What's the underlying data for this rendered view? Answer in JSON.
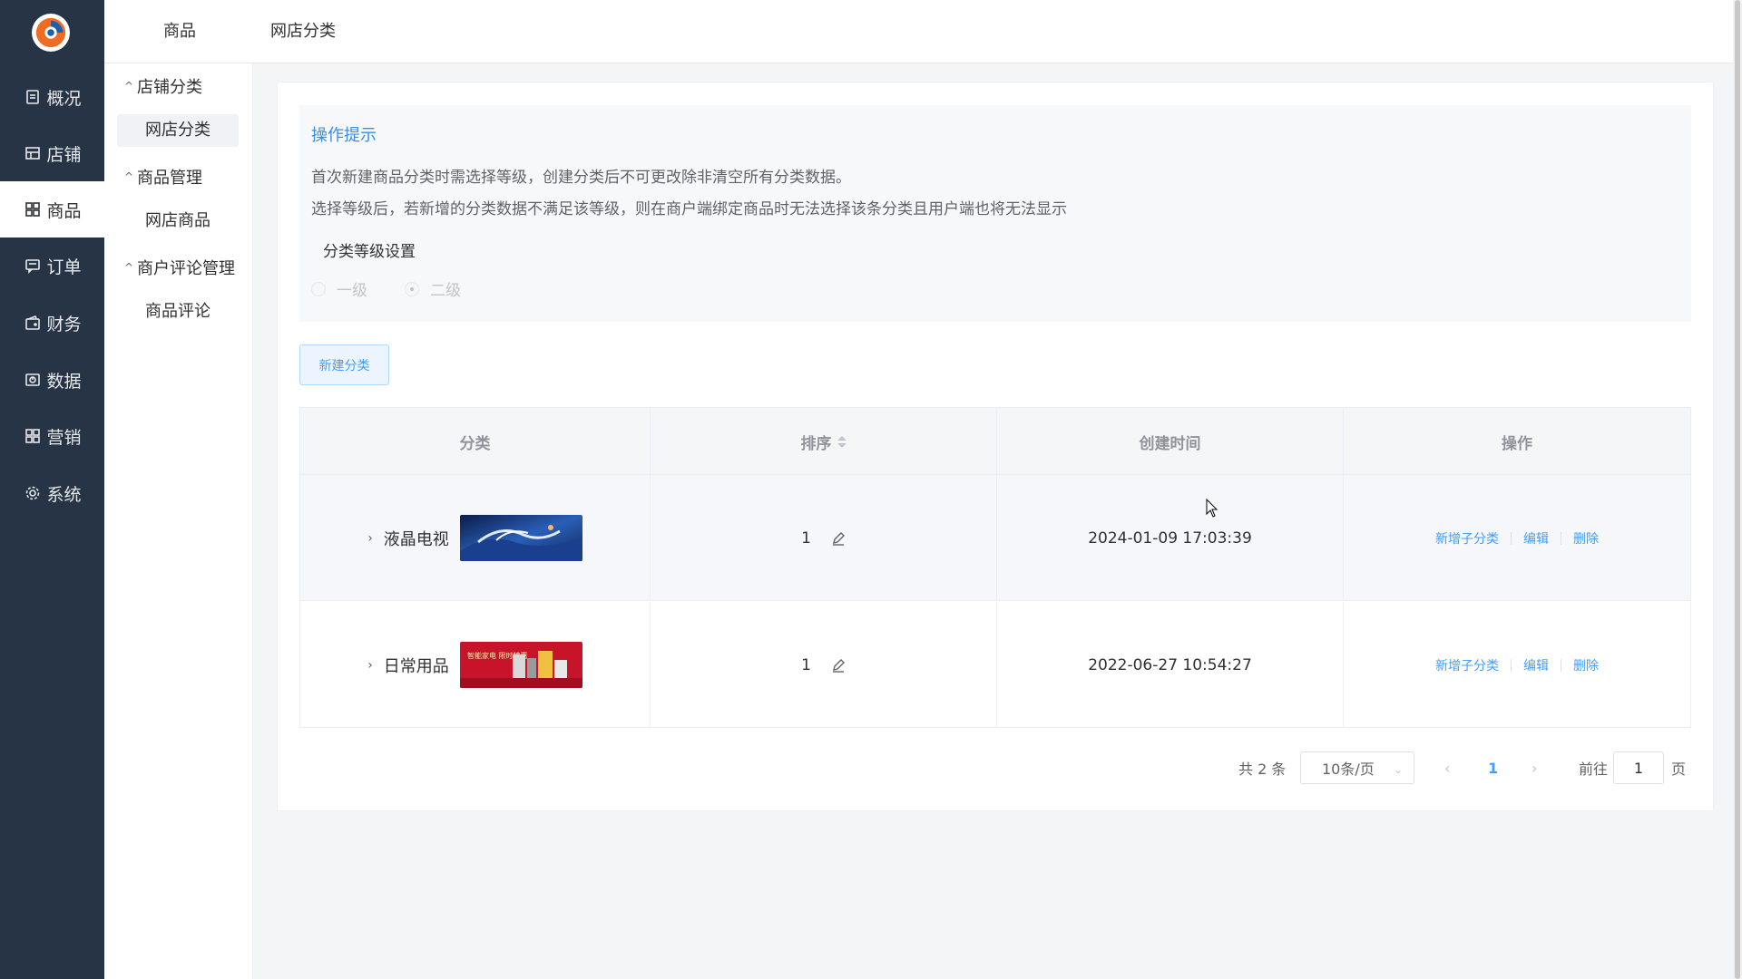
{
  "rail": {
    "items": [
      {
        "label": "概况",
        "icon": "document-icon"
      },
      {
        "label": "店铺",
        "icon": "store-icon"
      },
      {
        "label": "商品",
        "icon": "grid-icon"
      },
      {
        "label": "订单",
        "icon": "message-icon"
      },
      {
        "label": "财务",
        "icon": "wallet-icon"
      },
      {
        "label": "数据",
        "icon": "chart-icon"
      },
      {
        "label": "营销",
        "icon": "apps-icon"
      },
      {
        "label": "系统",
        "icon": "gear-icon"
      }
    ],
    "active_index": 2
  },
  "topbar": {
    "tabs": [
      "商品",
      "网店分类"
    ]
  },
  "subnav": {
    "groups": [
      {
        "label": "店铺分类",
        "items": [
          "网店分类"
        ]
      },
      {
        "label": "商品管理",
        "items": [
          "网店商品"
        ]
      },
      {
        "label": "商户评论管理",
        "items": [
          "商品评论"
        ]
      }
    ],
    "active_item": "网店分类"
  },
  "tips": {
    "title": "操作提示",
    "line1": "首次新建商品分类时需选择等级，创建分类后不可更改除非清空所有分类数据。",
    "line2": "选择等级后，若新增的分类数据不满足该等级，则在商户端绑定商品时无法选择该条分类且用户端也将无法显示",
    "level_title": "分类等级设置",
    "options": [
      "一级",
      "二级"
    ],
    "selected": "二级"
  },
  "actions": {
    "new_category": "新建分类"
  },
  "table": {
    "columns": [
      "分类",
      "排序",
      "创建时间",
      "操作"
    ],
    "rows": [
      {
        "name": "液晶电视",
        "sort": "1",
        "created": "2024-01-09 17:03:39",
        "ops": [
          "新增子分类",
          "编辑",
          "删除"
        ]
      },
      {
        "name": "日常用品",
        "sort": "1",
        "created": "2022-06-27 10:54:27",
        "ops": [
          "新增子分类",
          "编辑",
          "删除"
        ]
      }
    ],
    "thumb2_text": "智能家电 限时特惠"
  },
  "pagination": {
    "total": "共 2 条",
    "page_size": "10条/页",
    "current": "1",
    "goto_prefix": "前往",
    "goto_value": "1",
    "goto_suffix": "页"
  },
  "colors": {
    "rail_bg": "#263445",
    "accent": "#409eff",
    "tips_title": "#3a8ee6"
  }
}
